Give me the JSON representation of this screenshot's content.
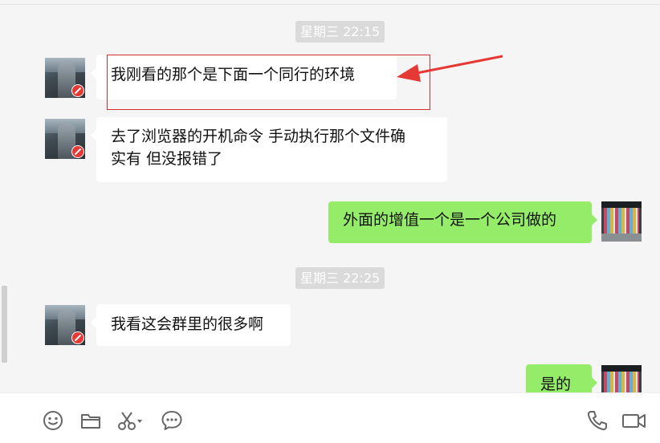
{
  "messages": [
    {
      "type": "time",
      "text": "星期三 22:15"
    },
    {
      "type": "msg",
      "side": "left",
      "text": "我刚看的那个是下面一个同行的环境",
      "highlighted": true
    },
    {
      "type": "msg",
      "side": "left",
      "lines": [
        "去了浏览器的开机命令 手动执行那个文件确",
        "实有 但没报错了"
      ]
    },
    {
      "type": "msg",
      "side": "right",
      "text": "外面的增值一个是一个公司做的"
    },
    {
      "type": "time",
      "text": "星期三 22:25"
    },
    {
      "type": "msg",
      "side": "left",
      "text": "我看这会群里的很多啊"
    },
    {
      "type": "msg",
      "side": "right",
      "text": "是的"
    }
  ],
  "toolbar": {
    "icons": [
      "emoji-icon",
      "folder-icon",
      "scissors-icon",
      "chat-history-icon",
      "phone-icon",
      "video-icon"
    ]
  },
  "colors": {
    "background": "#f5f5f5",
    "incoming_bubble": "#ffffff",
    "outgoing_bubble": "#95ec69",
    "timestamp_bg": "#dadada",
    "annotation": "#d32f2f",
    "unread_badge": "#e53935"
  }
}
